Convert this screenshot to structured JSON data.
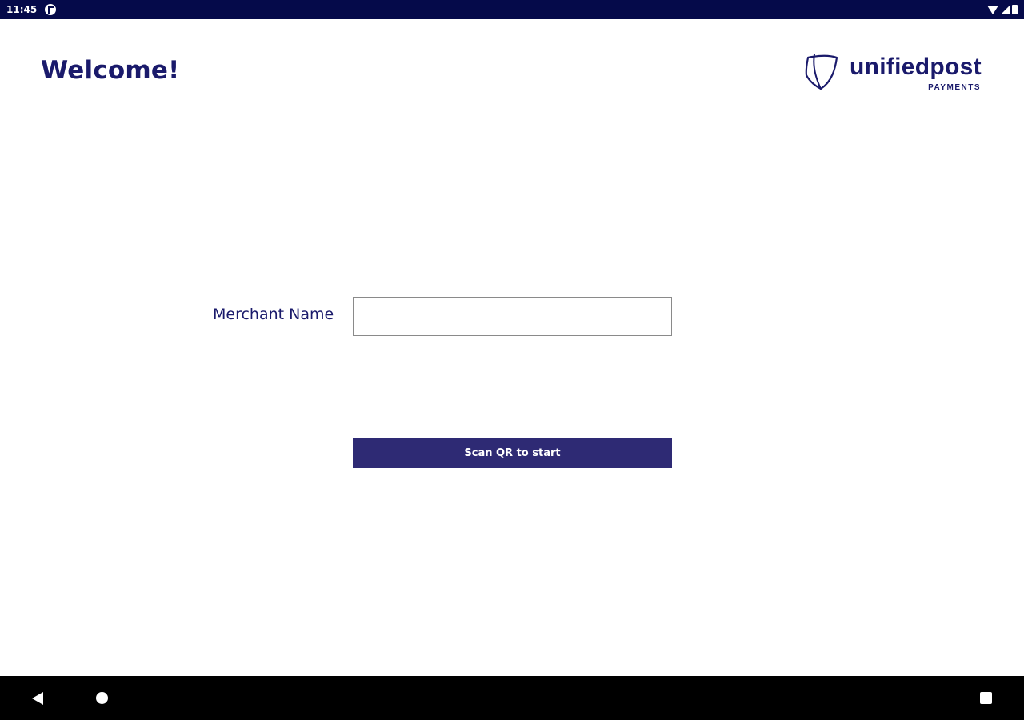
{
  "status_bar": {
    "time": "11:45",
    "icons": [
      "app-notification-icon",
      "wifi-icon",
      "signal-icon",
      "battery-icon"
    ]
  },
  "header": {
    "title": "Welcome!",
    "logo": {
      "word": "unifiedpost",
      "sub": "PAYMENTS"
    }
  },
  "form": {
    "merchant_label": "Merchant Name",
    "merchant_value": "",
    "merchant_placeholder": "",
    "scan_button_label": "Scan QR to start"
  },
  "nav_bar": {
    "buttons": [
      "back-icon",
      "home-icon",
      "recents-icon"
    ]
  },
  "colors": {
    "status_bar": "#050a4a",
    "brand_navy": "#1a1a6b",
    "button_bg": "#2e2a74",
    "nav_bar": "#000000"
  }
}
